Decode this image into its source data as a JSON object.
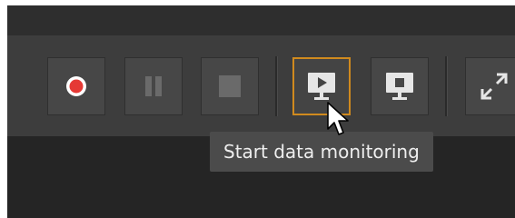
{
  "toolbar": {
    "buttons": [
      {
        "name": "record",
        "icon": "record-icon",
        "state": "enabled"
      },
      {
        "name": "pause",
        "icon": "pause-icon",
        "state": "disabled"
      },
      {
        "name": "stop",
        "icon": "stop-icon",
        "state": "disabled"
      },
      {
        "name": "start-data-monitoring",
        "icon": "monitor-play-icon",
        "state": "focused"
      },
      {
        "name": "stop-data-monitoring",
        "icon": "monitor-stop-icon",
        "state": "enabled"
      },
      {
        "name": "fullscreen",
        "icon": "expand-icon",
        "state": "enabled"
      }
    ],
    "tooltip": "Start data monitoring"
  },
  "colors": {
    "record_red": "#e53935",
    "focus_orange": "#d08a1e",
    "toolbar_bg": "#3d3d3d",
    "button_bg": "#474747",
    "icon_light": "#e6e6e6",
    "icon_disabled": "#6a6a6a"
  }
}
